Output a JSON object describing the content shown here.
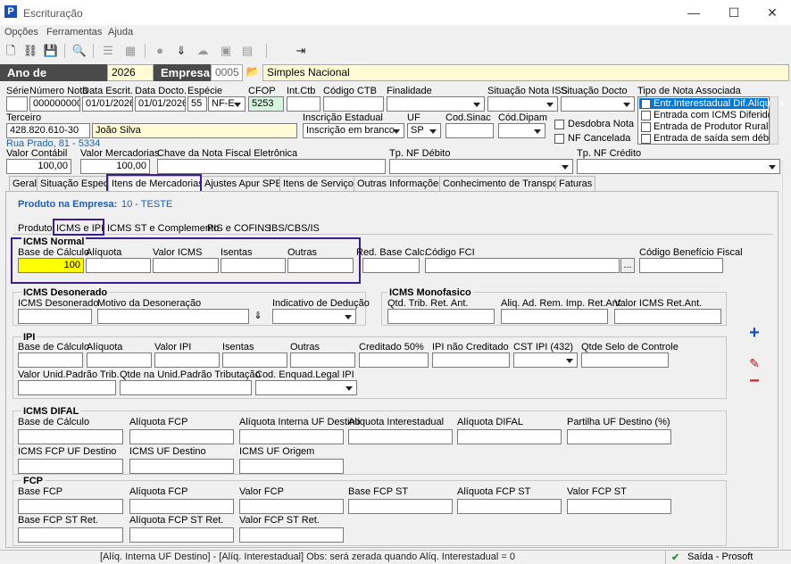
{
  "window": {
    "title": "Escrituração",
    "min": "—",
    "max": "☐",
    "close": "✕"
  },
  "menu": [
    "Opções",
    "Ferramentas",
    "Ajuda"
  ],
  "yearbar": {
    "ano_label": "Ano de Movimento",
    "ano": "2026",
    "empresa_label": "Empresa",
    "empresa_code": "0005",
    "empresa_name": "Simples Nacional"
  },
  "header": {
    "serie_label": "Série",
    "serie": "",
    "numero_label": "Número Nota",
    "numero": "0000000001",
    "data_escrit_label": "Data Escrit.",
    "data_escrit": "01/01/2026",
    "data_docto_label": "Data Docto.",
    "data_docto": "01/01/2026",
    "especie_label": "Espécie",
    "especie_code": "55",
    "especie": "NF-E",
    "cfop_label": "CFOP",
    "cfop": "5253",
    "intctb_label": "Int.Ctb",
    "intctb": "",
    "codctb_label": "Código CTB",
    "codctb": "",
    "finalidade_label": "Finalidade",
    "finalidade": "",
    "sit_iss_label": "Situação Nota ISS",
    "sit_iss": "",
    "sit_docto_label": "Situação Docto",
    "sit_docto": "",
    "tipo_label": "Tipo de Nota Associada",
    "tipo_items": [
      "Entr.Interestadual Dif.Alíquota",
      "Entrada com ICMS Diferido",
      "Entrada de Produtor Rural",
      "Entrada de saída sem débito"
    ],
    "terceiro_label": "Terceiro",
    "terceiro_doc": "428.820.610-30",
    "terceiro_nome": "João Silva",
    "terceiro_end": "Rua Prado, 81 - 5334",
    "ie_label": "Inscrição Estadual",
    "ie": "Inscrição em branco",
    "uf_label": "UF",
    "uf": "SP",
    "sinac_label": "Cod.Sinac",
    "sinac": "",
    "dipam_label": "Cód.Dipam",
    "dipam": "",
    "desdobra_label": "Desdobra Nota",
    "cancelada_label": "NF Cancelada",
    "vcontabil_label": "Valor Contábil",
    "vcontabil": "100,00",
    "vmerc_label": "Valor Mercadorias",
    "vmerc": "100,00",
    "chave_label": "Chave da Nota Fiscal Eletrônica",
    "chave": "",
    "tpdeb_label": "Tp. NF Débito",
    "tpdeb": "",
    "tpcred_label": "Tp. NF Crédito",
    "tpcred": ""
  },
  "tabs": [
    "Geral",
    "Situação Especial",
    "Itens de Mercadorias",
    "Ajustes Apur SPED",
    "Itens de Serviços",
    "Outras Informações",
    "Conhecimento de Transporte",
    "Faturas"
  ],
  "produto": {
    "label": "Produto na Empresa:",
    "value": "10 - TESTE"
  },
  "subtabs": [
    "Produto",
    "ICMS e IPI",
    "ICMS ST e Complemento",
    "PIS e COFINS",
    "IBS/CBS/IS"
  ],
  "icms_normal": {
    "title": "ICMS Normal",
    "base_label": "Base de Cálculo",
    "base": "100",
    "aliq_label": "Alíquota",
    "valor_label": "Valor ICMS",
    "isentas_label": "Isentas",
    "outras_label": "Outras",
    "red_label": "Red. Base Calc.",
    "fci_label": "Código FCI",
    "fci_btn": "...",
    "benef_label": "Código Benefício Fiscal"
  },
  "icms_desonerado": {
    "title": "ICMS Desonerado",
    "icms_label": "ICMS Desonerado",
    "motivo_label": "Motivo da Desoneração",
    "indicativo_label": "Indicativo de Dedução"
  },
  "icms_monofasico": {
    "title": "ICMS Monofasico",
    "qtd_label": "Qtd. Trib. Ret. Ant.",
    "aliq_label": "Aliq. Ad. Rem. Imp. Ret.Ant",
    "valor_label": "Valor ICMS Ret.Ant."
  },
  "ipi": {
    "title": "IPI",
    "base_label": "Base de Cálculo",
    "aliq_label": "Alíquota",
    "valor_label": "Valor IPI",
    "isentas_label": "Isentas",
    "outras_label": "Outras",
    "cred50_label": "Creditado 50%",
    "naocred_label": "IPI não Creditado",
    "cst_label": "CST IPI (432)",
    "selo_label": "Qtde Selo de Controle",
    "unid_label": "Valor Unid.Padrão Trib.",
    "qtde_label": "Qtde na Unid.Padrão Tributação",
    "enq_label": "Cod. Enquad.Legal IPI"
  },
  "difal": {
    "title": "ICMS DIFAL",
    "base_label": "Base de Cálculo",
    "aliqfcp_label": "Alíquota FCP",
    "aliqint_label": "Alíquota Interna UF Destino",
    "aliqinter_label": "Alíquota Interestadual",
    "aliqdifal_label": "Alíquota DIFAL",
    "partilha_label": "Partilha UF Destino (%)",
    "fcpdest_label": "ICMS FCP UF Destino",
    "ufdest_label": "ICMS UF Destino",
    "uforig_label": "ICMS UF Origem"
  },
  "fcp": {
    "title": "FCP",
    "base_label": "Base FCP",
    "aliq_label": "Alíquota FCP",
    "valor_label": "Valor FCP",
    "basest_label": "Base FCP ST",
    "aliqst_label": "Alíquota FCP ST",
    "valorst_label": "Valor FCP ST",
    "baseret_label": "Base FCP ST Ret.",
    "aliqret_label": "Alíquota FCP ST Ret.",
    "valorret_label": "Valor FCP ST Ret."
  },
  "status": {
    "message": "[Alíq. Interna UF Destino] - [Alíq. Interestadual] Obs: será zerada quando Alíq. Interestadual = 0",
    "exit": "Saída - Prosoft"
  },
  "colors": {
    "highlight": "#3b1d8f",
    "accent_blue": "#1a5fb4",
    "yellow": "#ffff00"
  }
}
